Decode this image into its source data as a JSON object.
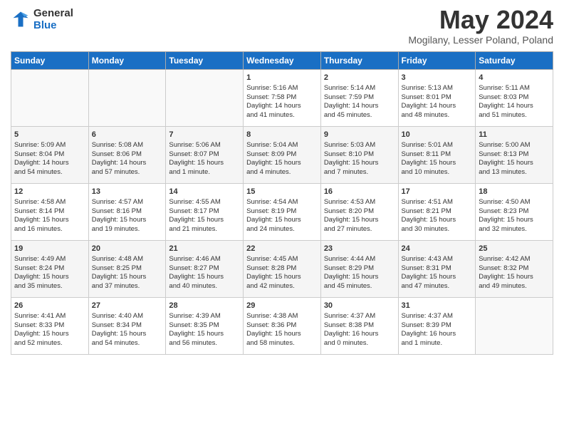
{
  "header": {
    "logo_line1": "General",
    "logo_line2": "Blue",
    "month": "May 2024",
    "location": "Mogilany, Lesser Poland, Poland"
  },
  "weekdays": [
    "Sunday",
    "Monday",
    "Tuesday",
    "Wednesday",
    "Thursday",
    "Friday",
    "Saturday"
  ],
  "weeks": [
    [
      {
        "day": "",
        "info": ""
      },
      {
        "day": "",
        "info": ""
      },
      {
        "day": "",
        "info": ""
      },
      {
        "day": "1",
        "info": "Sunrise: 5:16 AM\nSunset: 7:58 PM\nDaylight: 14 hours\nand 41 minutes."
      },
      {
        "day": "2",
        "info": "Sunrise: 5:14 AM\nSunset: 7:59 PM\nDaylight: 14 hours\nand 45 minutes."
      },
      {
        "day": "3",
        "info": "Sunrise: 5:13 AM\nSunset: 8:01 PM\nDaylight: 14 hours\nand 48 minutes."
      },
      {
        "day": "4",
        "info": "Sunrise: 5:11 AM\nSunset: 8:03 PM\nDaylight: 14 hours\nand 51 minutes."
      }
    ],
    [
      {
        "day": "5",
        "info": "Sunrise: 5:09 AM\nSunset: 8:04 PM\nDaylight: 14 hours\nand 54 minutes."
      },
      {
        "day": "6",
        "info": "Sunrise: 5:08 AM\nSunset: 8:06 PM\nDaylight: 14 hours\nand 57 minutes."
      },
      {
        "day": "7",
        "info": "Sunrise: 5:06 AM\nSunset: 8:07 PM\nDaylight: 15 hours\nand 1 minute."
      },
      {
        "day": "8",
        "info": "Sunrise: 5:04 AM\nSunset: 8:09 PM\nDaylight: 15 hours\nand 4 minutes."
      },
      {
        "day": "9",
        "info": "Sunrise: 5:03 AM\nSunset: 8:10 PM\nDaylight: 15 hours\nand 7 minutes."
      },
      {
        "day": "10",
        "info": "Sunrise: 5:01 AM\nSunset: 8:11 PM\nDaylight: 15 hours\nand 10 minutes."
      },
      {
        "day": "11",
        "info": "Sunrise: 5:00 AM\nSunset: 8:13 PM\nDaylight: 15 hours\nand 13 minutes."
      }
    ],
    [
      {
        "day": "12",
        "info": "Sunrise: 4:58 AM\nSunset: 8:14 PM\nDaylight: 15 hours\nand 16 minutes."
      },
      {
        "day": "13",
        "info": "Sunrise: 4:57 AM\nSunset: 8:16 PM\nDaylight: 15 hours\nand 19 minutes."
      },
      {
        "day": "14",
        "info": "Sunrise: 4:55 AM\nSunset: 8:17 PM\nDaylight: 15 hours\nand 21 minutes."
      },
      {
        "day": "15",
        "info": "Sunrise: 4:54 AM\nSunset: 8:19 PM\nDaylight: 15 hours\nand 24 minutes."
      },
      {
        "day": "16",
        "info": "Sunrise: 4:53 AM\nSunset: 8:20 PM\nDaylight: 15 hours\nand 27 minutes."
      },
      {
        "day": "17",
        "info": "Sunrise: 4:51 AM\nSunset: 8:21 PM\nDaylight: 15 hours\nand 30 minutes."
      },
      {
        "day": "18",
        "info": "Sunrise: 4:50 AM\nSunset: 8:23 PM\nDaylight: 15 hours\nand 32 minutes."
      }
    ],
    [
      {
        "day": "19",
        "info": "Sunrise: 4:49 AM\nSunset: 8:24 PM\nDaylight: 15 hours\nand 35 minutes."
      },
      {
        "day": "20",
        "info": "Sunrise: 4:48 AM\nSunset: 8:25 PM\nDaylight: 15 hours\nand 37 minutes."
      },
      {
        "day": "21",
        "info": "Sunrise: 4:46 AM\nSunset: 8:27 PM\nDaylight: 15 hours\nand 40 minutes."
      },
      {
        "day": "22",
        "info": "Sunrise: 4:45 AM\nSunset: 8:28 PM\nDaylight: 15 hours\nand 42 minutes."
      },
      {
        "day": "23",
        "info": "Sunrise: 4:44 AM\nSunset: 8:29 PM\nDaylight: 15 hours\nand 45 minutes."
      },
      {
        "day": "24",
        "info": "Sunrise: 4:43 AM\nSunset: 8:31 PM\nDaylight: 15 hours\nand 47 minutes."
      },
      {
        "day": "25",
        "info": "Sunrise: 4:42 AM\nSunset: 8:32 PM\nDaylight: 15 hours\nand 49 minutes."
      }
    ],
    [
      {
        "day": "26",
        "info": "Sunrise: 4:41 AM\nSunset: 8:33 PM\nDaylight: 15 hours\nand 52 minutes."
      },
      {
        "day": "27",
        "info": "Sunrise: 4:40 AM\nSunset: 8:34 PM\nDaylight: 15 hours\nand 54 minutes."
      },
      {
        "day": "28",
        "info": "Sunrise: 4:39 AM\nSunset: 8:35 PM\nDaylight: 15 hours\nand 56 minutes."
      },
      {
        "day": "29",
        "info": "Sunrise: 4:38 AM\nSunset: 8:36 PM\nDaylight: 15 hours\nand 58 minutes."
      },
      {
        "day": "30",
        "info": "Sunrise: 4:37 AM\nSunset: 8:38 PM\nDaylight: 16 hours\nand 0 minutes."
      },
      {
        "day": "31",
        "info": "Sunrise: 4:37 AM\nSunset: 8:39 PM\nDaylight: 16 hours\nand 1 minute."
      },
      {
        "day": "",
        "info": ""
      }
    ]
  ]
}
